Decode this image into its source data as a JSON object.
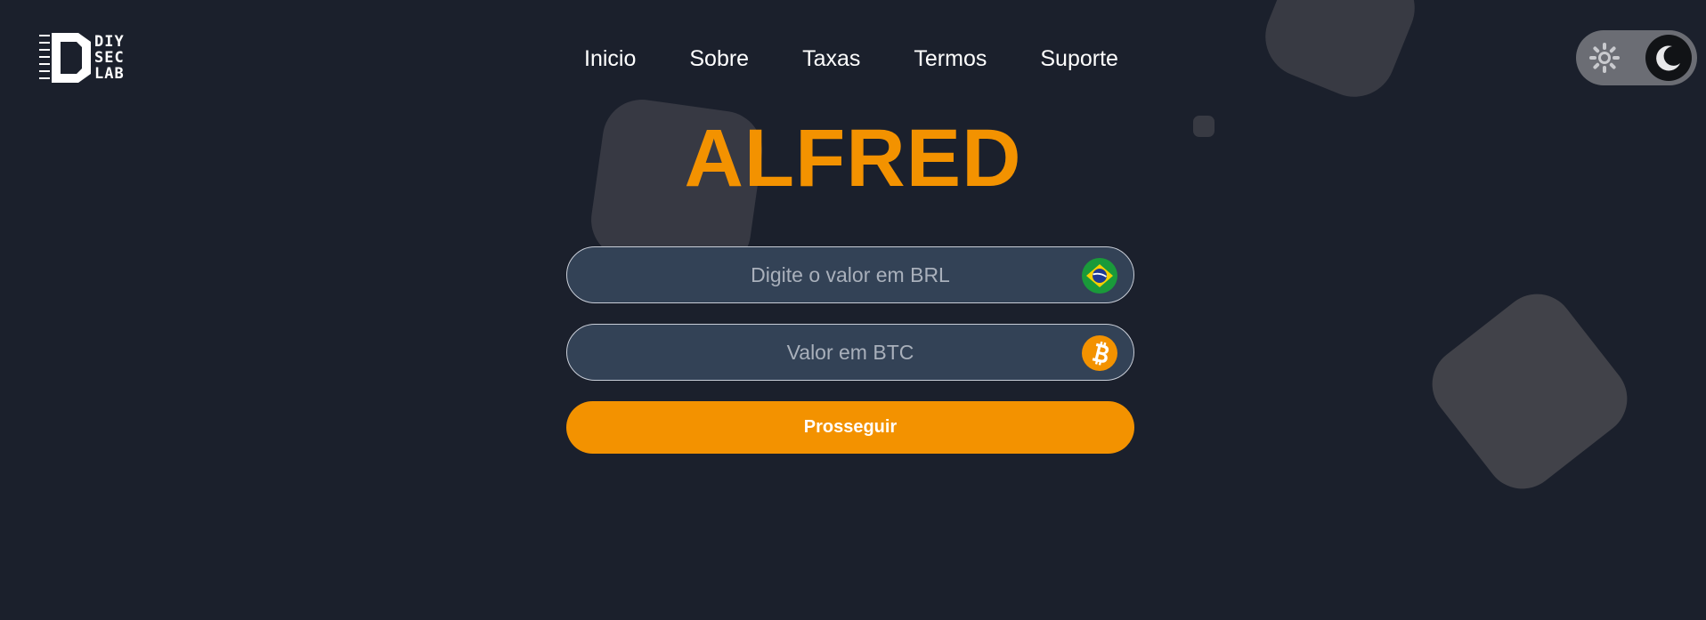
{
  "brand": {
    "logo_lines": [
      "DIY",
      "SEC",
      "LAB"
    ]
  },
  "nav": {
    "items": [
      {
        "label": "Inicio"
      },
      {
        "label": "Sobre"
      },
      {
        "label": "Taxas"
      },
      {
        "label": "Termos"
      },
      {
        "label": "Suporte"
      }
    ]
  },
  "theme_toggle": {
    "light_icon": "sun-icon",
    "dark_icon": "moon-icon",
    "active": "dark"
  },
  "hero": {
    "title": "ALFRED"
  },
  "form": {
    "brl_input": {
      "placeholder": "Digite o valor em BRL",
      "value": "",
      "icon": "brazil-flag-icon"
    },
    "btc_input": {
      "placeholder": "Valor em BTC",
      "value": "",
      "icon": "bitcoin-icon"
    },
    "submit_label": "Prosseguir"
  },
  "colors": {
    "background": "#1b202c",
    "accent": "#f39200",
    "input_bg": "#334256",
    "toggle_bg": "#6b6d74"
  }
}
